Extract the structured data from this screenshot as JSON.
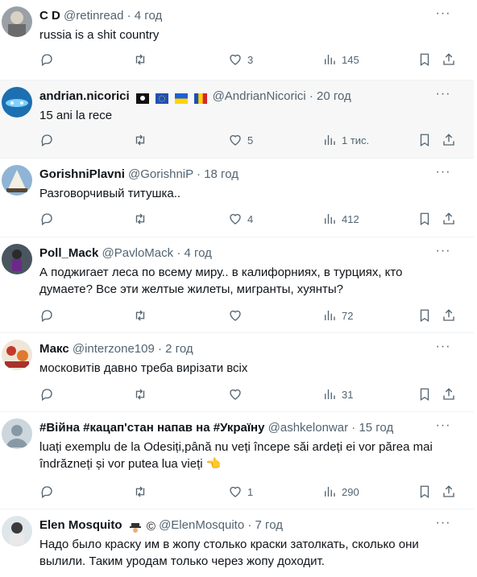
{
  "tweets": [
    {
      "name": "C D",
      "handle": "@retinread",
      "time": "4 год",
      "text": "russia is a shit country",
      "likes": "3",
      "views": "145"
    },
    {
      "name": "andrian.nicorici",
      "handle": "@AndrianNicorici",
      "time": "20 год",
      "text": "15 ani la rece",
      "likes": "5",
      "views": "1 тис."
    },
    {
      "name": "GorishniPlavni",
      "handle": "@GorishniP",
      "time": "18 год",
      "text": "Разговорчивый титушка..",
      "likes": "4",
      "views": "412"
    },
    {
      "name": "Poll_Mack",
      "handle": "@PavloMack",
      "time": "4 год",
      "text": "А поджигает леса по всему миру.. в калифорниях, в турциях, кто думаете? Все эти желтые жилеты, мигранты, хуянты?",
      "likes": "",
      "views": "72"
    },
    {
      "name": "Макс",
      "handle": "@interzone109",
      "time": "2 год",
      "text": "московитів давно треба вирізати всіх",
      "likes": "",
      "views": "31"
    },
    {
      "name": "#Війна #кацап'стан напав на #Україну",
      "handle": "@ashkelonwar",
      "time": "15 год",
      "text": "luați exemplu de la Odesiți,până nu veți începe săi ardeți ei vor părea mai îndrăzneți și vor putea lua vieți 👈",
      "likes": "1",
      "views": "290"
    },
    {
      "name": "Elen Mosquito",
      "handle": "@ElenMosquito",
      "time": "7 год",
      "text": "Надо было краску им в жопу столько краски затолкать, сколько они вылили. Таким уродам только через жопу доходит.",
      "likes": "",
      "views": ""
    }
  ],
  "icons": {
    "more": "more-icon",
    "reply": "reply-icon",
    "retweet": "retweet-icon",
    "like": "like-icon",
    "views": "views-icon",
    "bookmark": "bookmark-icon",
    "share": "share-icon"
  },
  "badges_text": {
    "sep": "·",
    "emoji_elen": "©"
  }
}
